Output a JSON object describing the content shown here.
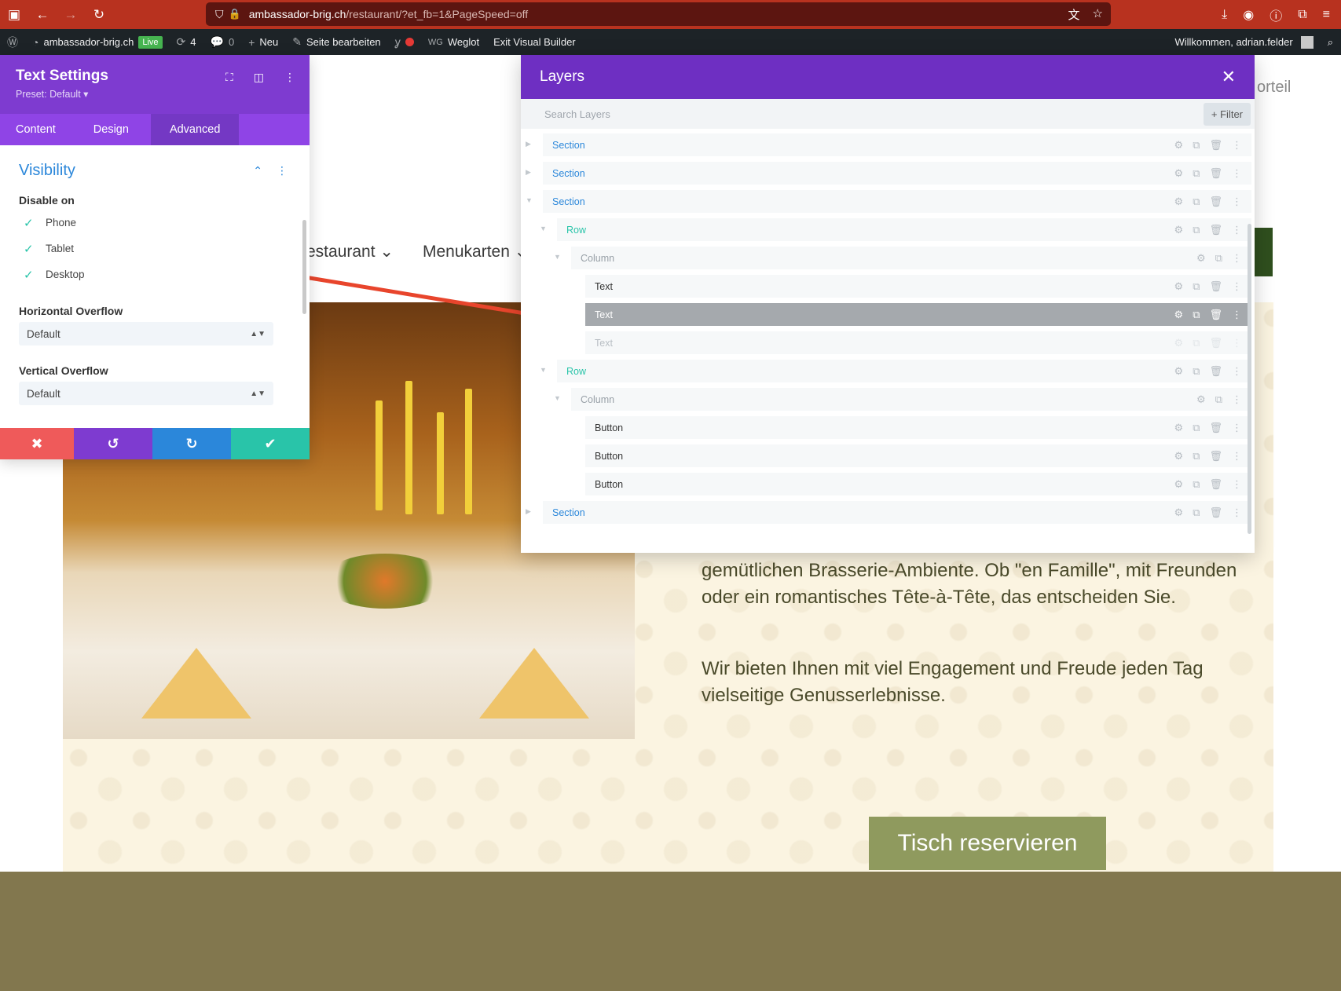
{
  "browser": {
    "url_domain": "ambassador-brig.ch",
    "url_path": "/restaurant/?et_fb=1&PageSpeed=off"
  },
  "wp_bar": {
    "site_name": "ambassador-brig.ch",
    "live_badge": "Live",
    "updates_count": "4",
    "comments_count": "0",
    "new_label": "Neu",
    "edit_page_label": "Seite bearbeiten",
    "weglot_label": "Weglot",
    "exit_builder_label": "Exit Visual Builder",
    "welcome_text": "Willkommen, adrian.felder"
  },
  "settings_panel": {
    "title": "Text Settings",
    "preset": "Preset: Default ▾",
    "tabs": [
      "Content",
      "Design",
      "Advanced"
    ],
    "active_tab": "Advanced",
    "section_title": "Visibility",
    "disable_on_label": "Disable on",
    "disable_options": [
      {
        "label": "Phone",
        "checked": true
      },
      {
        "label": "Tablet",
        "checked": true
      },
      {
        "label": "Desktop",
        "checked": true
      }
    ],
    "horizontal_overflow_label": "Horizontal Overflow",
    "horizontal_overflow_value": "Default",
    "vertical_overflow_label": "Vertical Overflow",
    "vertical_overflow_value": "Default",
    "colors": {
      "header": "#7e3bd0",
      "discard": "#ef5a5a",
      "undo": "#7e3bd0",
      "redo": "#2b87da",
      "save": "#29c4a9"
    }
  },
  "layers_panel": {
    "title": "Layers",
    "search_placeholder": "Search Layers",
    "filter_label": "+ Filter",
    "items": [
      {
        "label": "Section",
        "type": "section",
        "depth": 0,
        "expanded": false
      },
      {
        "label": "Section",
        "type": "section",
        "depth": 0,
        "expanded": false
      },
      {
        "label": "Section",
        "type": "section",
        "depth": 0,
        "expanded": true
      },
      {
        "label": "Row",
        "type": "row",
        "depth": 1,
        "expanded": true
      },
      {
        "label": "Column",
        "type": "column",
        "depth": 2,
        "expanded": true
      },
      {
        "label": "Text",
        "type": "module",
        "depth": 3
      },
      {
        "label": "Text",
        "type": "module",
        "depth": 3,
        "selected": true
      },
      {
        "label": "Text",
        "type": "module",
        "depth": 3,
        "faded": true
      },
      {
        "label": "Row",
        "type": "row",
        "depth": 1,
        "expanded": true
      },
      {
        "label": "Column",
        "type": "column",
        "depth": 2,
        "expanded": true
      },
      {
        "label": "Button",
        "type": "module",
        "depth": 3
      },
      {
        "label": "Button",
        "type": "module",
        "depth": 3
      },
      {
        "label": "Button",
        "type": "module",
        "depth": 3
      },
      {
        "label": "Section",
        "type": "section",
        "depth": 0,
        "expanded": false
      }
    ]
  },
  "site": {
    "topnav_partial": "orteil",
    "menu_restaurant": "estaurant ⌄",
    "menu_menukarten": "Menukarten ⌄",
    "paragraph_1": "gemütlichen Brasserie-Ambiente. Ob \"en Famille\", mit Freunden oder ein romantisches Tête-à-Tête, das entscheiden Sie.",
    "paragraph_2": "Wir bieten Ihnen mit viel Engagement und Freude jeden Tag vielseitige Genusserlebnisse.",
    "cta_label": "Tisch reservieren"
  }
}
